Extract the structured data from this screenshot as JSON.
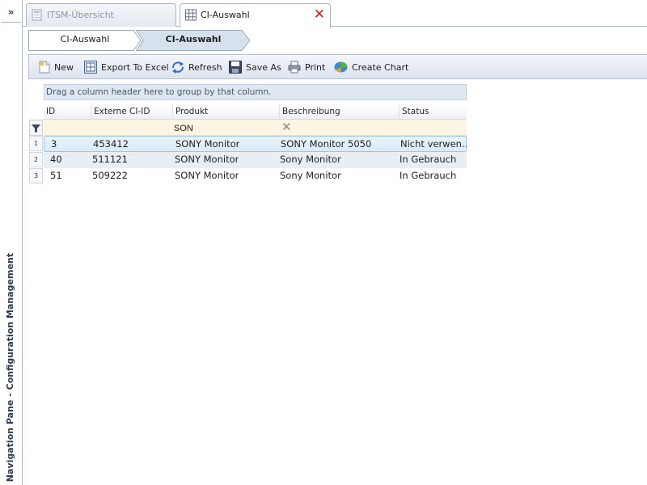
{
  "navigation": {
    "expand_glyph": "»",
    "title": "Navigation Pane - Configuration Management"
  },
  "tabs": [
    {
      "label": "ITSM-Übersicht",
      "icon": "document-icon",
      "active": false
    },
    {
      "label": "CI-Auswahl",
      "icon": "grid-icon",
      "active": true,
      "close_glyph": "✕"
    }
  ],
  "breadcrumb": [
    "CI-Auswahl",
    "CI-Auswahl"
  ],
  "toolbar": {
    "new_label": "New",
    "export_label": "Export To Excel",
    "refresh_label": "Refresh",
    "saveas_label": "Save As",
    "print_label": "Print",
    "chart_label": "Create Chart"
  },
  "grid": {
    "group_hint": "Drag a column header here to group by that column.",
    "columns": [
      "ID",
      "Externe CI-ID",
      "Produkt",
      "Beschreibung",
      "Status"
    ],
    "filter": {
      "produkt_value": "SON",
      "clear_glyph": "✕"
    },
    "rows": [
      {
        "num": "1",
        "id": "3",
        "ext": "453412",
        "produkt": "SONY Monitor",
        "beschreibung": "SONY Monitor 5050",
        "status": "Nicht verwen…"
      },
      {
        "num": "2",
        "id": "40",
        "ext": "511121",
        "produkt": "SONY Monitor",
        "beschreibung": "Sony Monitor",
        "status": "In Gebrauch"
      },
      {
        "num": "3",
        "id": "51",
        "ext": "509222",
        "produkt": "SONY Monitor",
        "beschreibung": "Sony Monitor",
        "status": "In Gebrauch"
      }
    ]
  },
  "colors": {
    "accent": "#9ec8ea",
    "close": "#d02020",
    "filter_bg": "#fdf5e2"
  }
}
